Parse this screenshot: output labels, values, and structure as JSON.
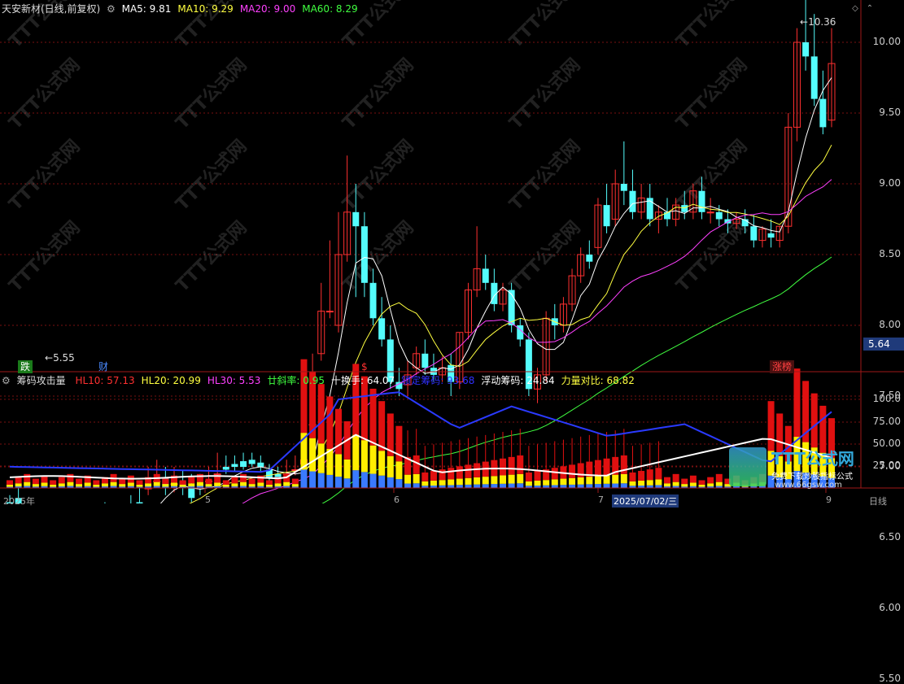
{
  "main": {
    "title": "天安新材(日线,前复权)",
    "ma": [
      {
        "label": "MA5: 9.81",
        "color": "#ffffff"
      },
      {
        "label": "MA10: 9.29",
        "color": "#ffff40"
      },
      {
        "label": "MA20: 9.00",
        "color": "#ff40ff"
      },
      {
        "label": "MA60: 8.29",
        "color": "#40ff40"
      }
    ],
    "y_ticks": [
      "10.00",
      "9.50",
      "9.00",
      "8.50",
      "8.00",
      "7.50",
      "7.00",
      "6.50",
      "6.00",
      "5.50"
    ],
    "current_price": "5.64",
    "high_label": "10.36",
    "low_label": "5.55",
    "markers": [
      {
        "text": "跌",
        "color": "#ffffff",
        "bg": "#1a7a1a"
      },
      {
        "text": "财",
        "color": "#4a8aff",
        "bg": ""
      },
      {
        "text": "$",
        "color": "#ff3030",
        "bg": ""
      },
      {
        "text": "涨榜",
        "color": "#ff4040",
        "bg": "#4a1010"
      }
    ]
  },
  "sub": {
    "title": "筹码攻击量",
    "items": [
      {
        "label": "HL10: 57.13",
        "color": "#ff3030"
      },
      {
        "label": "HL20: 20.99",
        "color": "#ffff40"
      },
      {
        "label": "HL30: 5.53",
        "color": "#ff40ff"
      },
      {
        "label": "廿斜率: 0.95",
        "color": "#40ff40"
      },
      {
        "label": "十换手: 64.07",
        "color": "#ffffff"
      },
      {
        "label": "锁定筹码: 93.68",
        "color": "#3030ff"
      },
      {
        "label": "浮动筹码: 24.84",
        "color": "#ffffff"
      },
      {
        "label": "力量对比: 68.82",
        "color": "#ffff40"
      }
    ],
    "y_ticks": [
      "100.0",
      "75.00",
      "50.00",
      "25.00"
    ]
  },
  "bottom": {
    "date_labels": [
      "2025年",
      "5",
      "6",
      "7",
      "2025/07/02/三",
      "9",
      "日线"
    ]
  },
  "watermark": {
    "text": "TTT公式网",
    "site": "www.66gsw.com",
    "slogan": "免费下载炒股指标公式"
  }
}
